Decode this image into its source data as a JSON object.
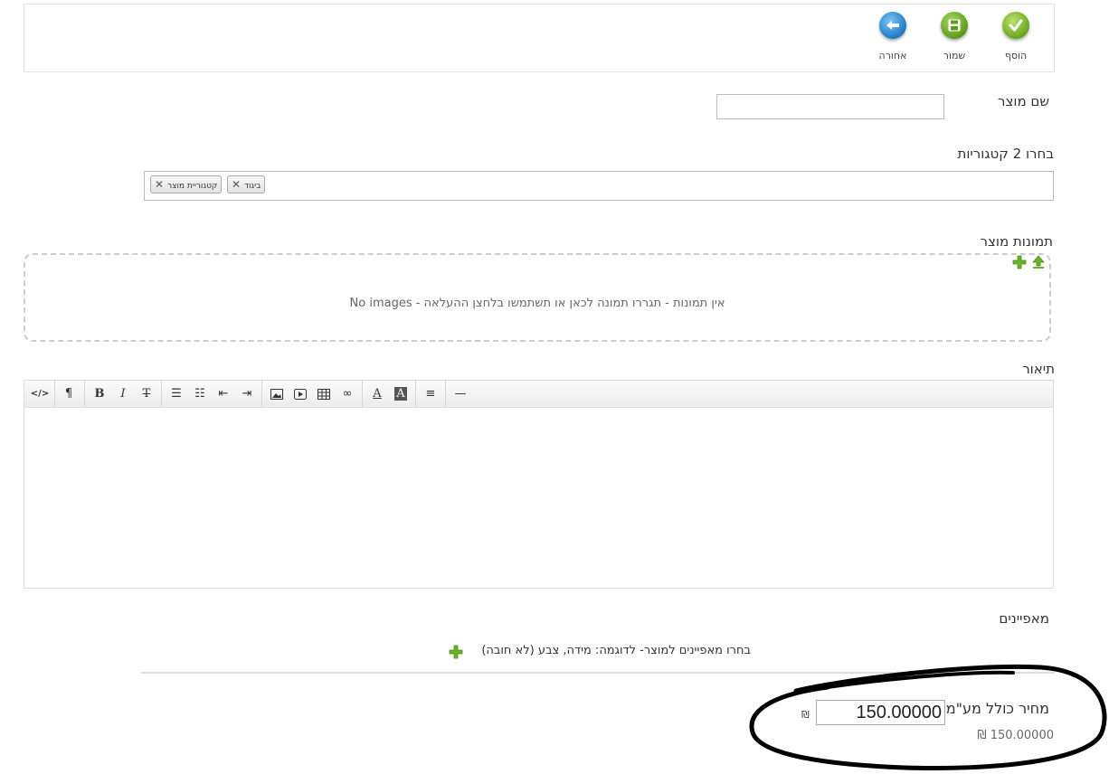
{
  "toolbar": {
    "buttons": [
      {
        "label": "הוסף",
        "icon": "check-icon"
      },
      {
        "label": "שמור",
        "icon": "save-icon"
      },
      {
        "label": "אחורה",
        "icon": "back-arrow-icon"
      }
    ]
  },
  "product_name": {
    "label": "שם מוצר",
    "value": ""
  },
  "categories": {
    "label": "בחרו 2 קטגוריות",
    "selected": [
      "ביגוד",
      "קטגוריית מוצר"
    ]
  },
  "images": {
    "label": "תמונות מוצר",
    "empty_text": "No images - אין תמונות - תגררו תמונה לכאן או תשתמשו בלחצן ההעלאה",
    "icons": [
      "add-icon",
      "upload-icon"
    ]
  },
  "description": {
    "label": "תיאור",
    "toolbar_icons": [
      "html-icon",
      "paragraph-icon",
      "bold-icon",
      "italic-icon",
      "strikethrough-icon",
      "unordered-list-icon",
      "ordered-list-icon",
      "outdent-icon",
      "indent-icon",
      "image-icon",
      "video-icon",
      "table-icon",
      "link-icon",
      "font-color-icon",
      "background-color-icon",
      "align-icon",
      "horizontal-rule-icon"
    ]
  },
  "attributes": {
    "label": "מאפיינים",
    "hint": "בחרו מאפיינים למוצר- לדוגמה: מידה, צבע (לא חובה)"
  },
  "price": {
    "label": "מחיר כולל מע\"מ",
    "value": "150.00000",
    "currency": "₪",
    "display": "150.00000"
  },
  "colors": {
    "annotation": "#000000",
    "accent_green": "#6aa61c",
    "accent_blue": "#1f7cc7"
  }
}
